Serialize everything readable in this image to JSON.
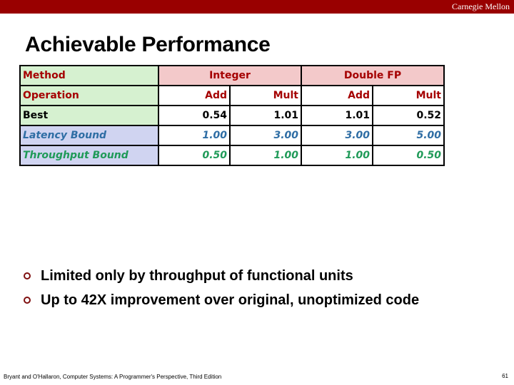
{
  "header": {
    "brand": "Carnegie Mellon"
  },
  "slide": {
    "title": "Achievable Performance"
  },
  "table": {
    "method_label": "Method",
    "groups": [
      "Integer",
      "Double FP"
    ],
    "operation_label": "Operation",
    "operations": [
      "Add",
      "Mult",
      "Add",
      "Mult"
    ],
    "rows": [
      {
        "label": "Best",
        "values": [
          "0.54",
          "1.01",
          "1.01",
          "0.52"
        ]
      },
      {
        "label": "Latency Bound",
        "values": [
          "1.00",
          "3.00",
          "3.00",
          "5.00"
        ]
      },
      {
        "label": "Throughput Bound",
        "values": [
          "0.50",
          "1.00",
          "1.00",
          "0.50"
        ]
      }
    ]
  },
  "bullets": [
    "Limited only by throughput of functional units",
    "Up to 42X improvement over original, unoptimized code"
  ],
  "footer": {
    "citation": "Bryant and O'Hallaron, Computer Systems: A Programmer's Perspective, Third Edition",
    "page_number": "61"
  }
}
